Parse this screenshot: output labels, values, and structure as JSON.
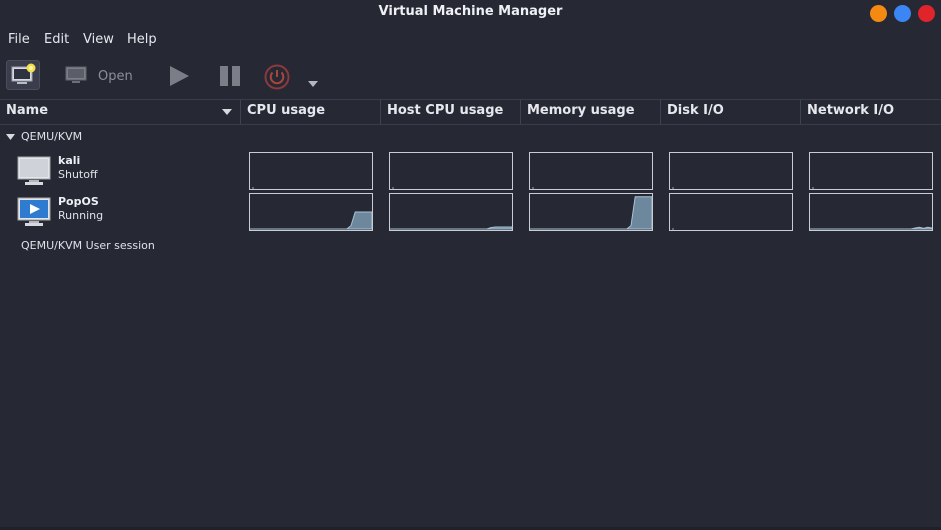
{
  "window": {
    "title": "Virtual Machine Manager"
  },
  "menu": {
    "file": "File",
    "edit": "Edit",
    "view": "View",
    "help": "Help"
  },
  "toolbar": {
    "open_label": "Open"
  },
  "columns": {
    "name": "Name",
    "cpu": "CPU usage",
    "host_cpu": "Host CPU usage",
    "memory": "Memory usage",
    "disk": "Disk I/O",
    "network": "Network I/O"
  },
  "groups": [
    {
      "label": "QEMU/KVM",
      "vms": [
        {
          "name": "kali",
          "status": "Shutoff",
          "graphs": {
            "cpu": [],
            "host_cpu": [],
            "memory": [],
            "disk": [],
            "network": []
          }
        },
        {
          "name": "PopOS",
          "status": "Running",
          "graphs": {
            "cpu": [
              0,
              0,
              0,
              0,
              0,
              0,
              0,
              0,
              0,
              0,
              0,
              0,
              0,
              0,
              0,
              0,
              0,
              0,
              0,
              0,
              0,
              0,
              0,
              0,
              0.1,
              0.5,
              0.5,
              0.5,
              0.5,
              0.5
            ],
            "host_cpu": [
              0,
              0,
              0,
              0,
              0,
              0,
              0,
              0,
              0,
              0,
              0,
              0,
              0,
              0,
              0,
              0,
              0,
              0,
              0,
              0,
              0,
              0,
              0,
              0,
              0.04,
              0.06,
              0.06,
              0.06,
              0.06,
              0.06
            ],
            "memory": [
              0,
              0,
              0,
              0,
              0,
              0,
              0,
              0,
              0,
              0,
              0,
              0,
              0,
              0,
              0,
              0,
              0,
              0,
              0,
              0,
              0,
              0,
              0,
              0,
              0.1,
              0.95,
              0.95,
              0.95,
              0.95,
              0.95
            ],
            "disk": [],
            "network": [
              0,
              0,
              0,
              0,
              0,
              0,
              0,
              0,
              0,
              0,
              0,
              0,
              0,
              0,
              0,
              0,
              0,
              0,
              0,
              0,
              0,
              0,
              0,
              0,
              0,
              0.03,
              0.05,
              0.02,
              0.05,
              0.03
            ]
          }
        }
      ]
    },
    {
      "label": "QEMU/KVM User session",
      "vms": []
    }
  ],
  "colors": {
    "graph_fill": "#7a99b0",
    "graph_line": "#a9c3d6",
    "graph_border": "#c9ccd4"
  }
}
